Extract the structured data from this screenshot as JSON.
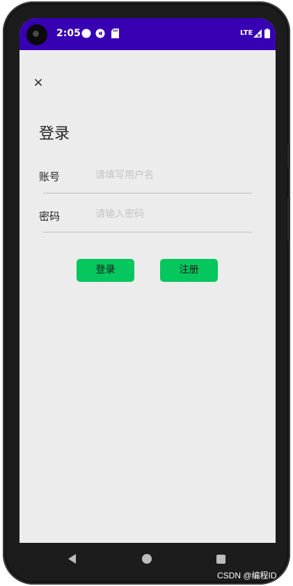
{
  "status_bar": {
    "time": "2:05",
    "network": "LTE"
  },
  "toolbar": {
    "close_icon": "×"
  },
  "login": {
    "title": "登录",
    "account_label": "账号",
    "account_placeholder": "请填写用户名",
    "password_label": "密码",
    "password_placeholder": "请输入密码",
    "login_button": "登录",
    "register_button": "注册"
  },
  "colors": {
    "status_bar": "#3700b3",
    "button": "#06c65e",
    "background": "#ececec"
  },
  "watermark": "CSDN @编程ID"
}
